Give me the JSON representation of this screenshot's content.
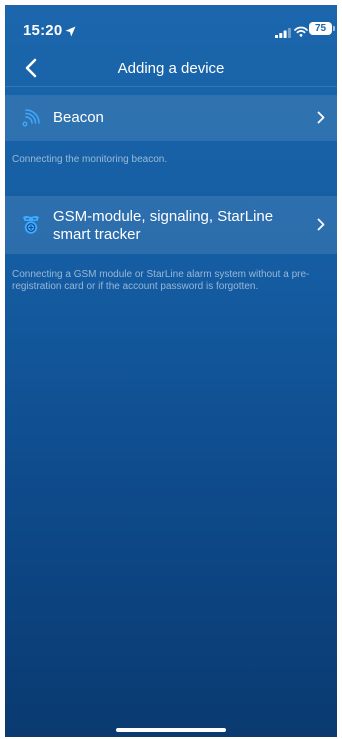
{
  "status_bar": {
    "time": "15:20",
    "battery": "75"
  },
  "nav": {
    "title": "Adding a device",
    "back_icon": "chevron-left-icon"
  },
  "options": [
    {
      "label": "Beacon",
      "icon": "beacon-signal-icon",
      "description": "Connecting the monitoring beacon."
    },
    {
      "label": "GSM-module, signaling, StarLine smart tracker",
      "icon": "starline-alarm-icon",
      "description": "Connecting a GSM module or StarLine alarm system without a pre-registration card or if the account password is forgotten."
    }
  ],
  "colors": {
    "background_top": "#1b66ac",
    "background_bottom": "#0a3a70",
    "icon_accent": "#3da9ff"
  }
}
